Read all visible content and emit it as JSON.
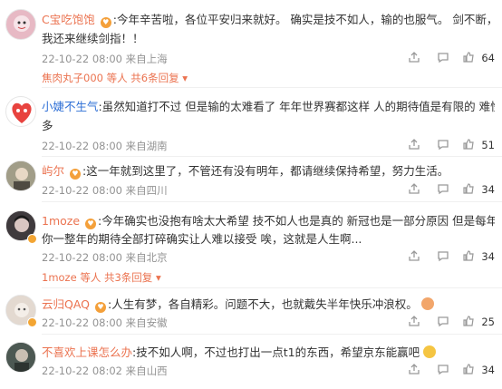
{
  "comments": [
    {
      "user": "C宝吃饱饱",
      "text": "今年辛苦啦，各位平安归来就好。 确实是技不如人，输的也服气。 剑不断，指不烂，明年",
      "text2": "我还来继续剑指！！",
      "time": "22-10-22 08:00",
      "location": "来自上海",
      "likes": "64",
      "sub_user": "焦肉丸子000",
      "sub_count": "等人  共6条回复",
      "avatar_color": "#e7b9c4"
    },
    {
      "user": "小婕不生气",
      "text": "虽然知道打不过 但是输的太难看了 年年世界赛都这样 人的期待值是有限的 难怪你黑粉这么",
      "text2": "多",
      "time": "22-10-22 08:00",
      "location": "来自湖南",
      "likes": "51",
      "avatar_color": "#e8433f"
    },
    {
      "user": "屿尔",
      "text": "这一年就到这里了，不管还有没有明年，都请继续保持希望，努力生活。",
      "time": "22-10-22 08:00",
      "location": "来自四川",
      "likes": "34",
      "avatar_color": "#8e8b78"
    },
    {
      "user": "1moze",
      "text": "今年确实也没抱有啥太大希望 技不如人也是真的 新冠也是一部分原因 但是每年的这个时刻把",
      "text2": "你一整年的期待全部打碎确实让人难以接受  唉，这就是人生啊...",
      "time": "22-10-22 08:00",
      "location": "来自北京",
      "likes": "34",
      "sub_user": "1moze",
      "sub_count": "等人  共3条回复",
      "avatar_color": "#5b4f55"
    },
    {
      "user": "云归QAQ",
      "text": "人生有梦，各自精彩。问题不大，也就戴失半年快乐冲浪权。",
      "time": "22-10-22 08:00",
      "location": "来自安徽",
      "likes": "25",
      "avatar_color": "#d9cfc6"
    },
    {
      "user": "不喜欢上课怎么办",
      "text": "技不如人啊，不过也打出一点t1的东西，希望京东能赢吧",
      "time": "22-10-22 08:02",
      "location": "来自山西",
      "likes": "34",
      "avatar_color": "#5d6a63"
    }
  ]
}
